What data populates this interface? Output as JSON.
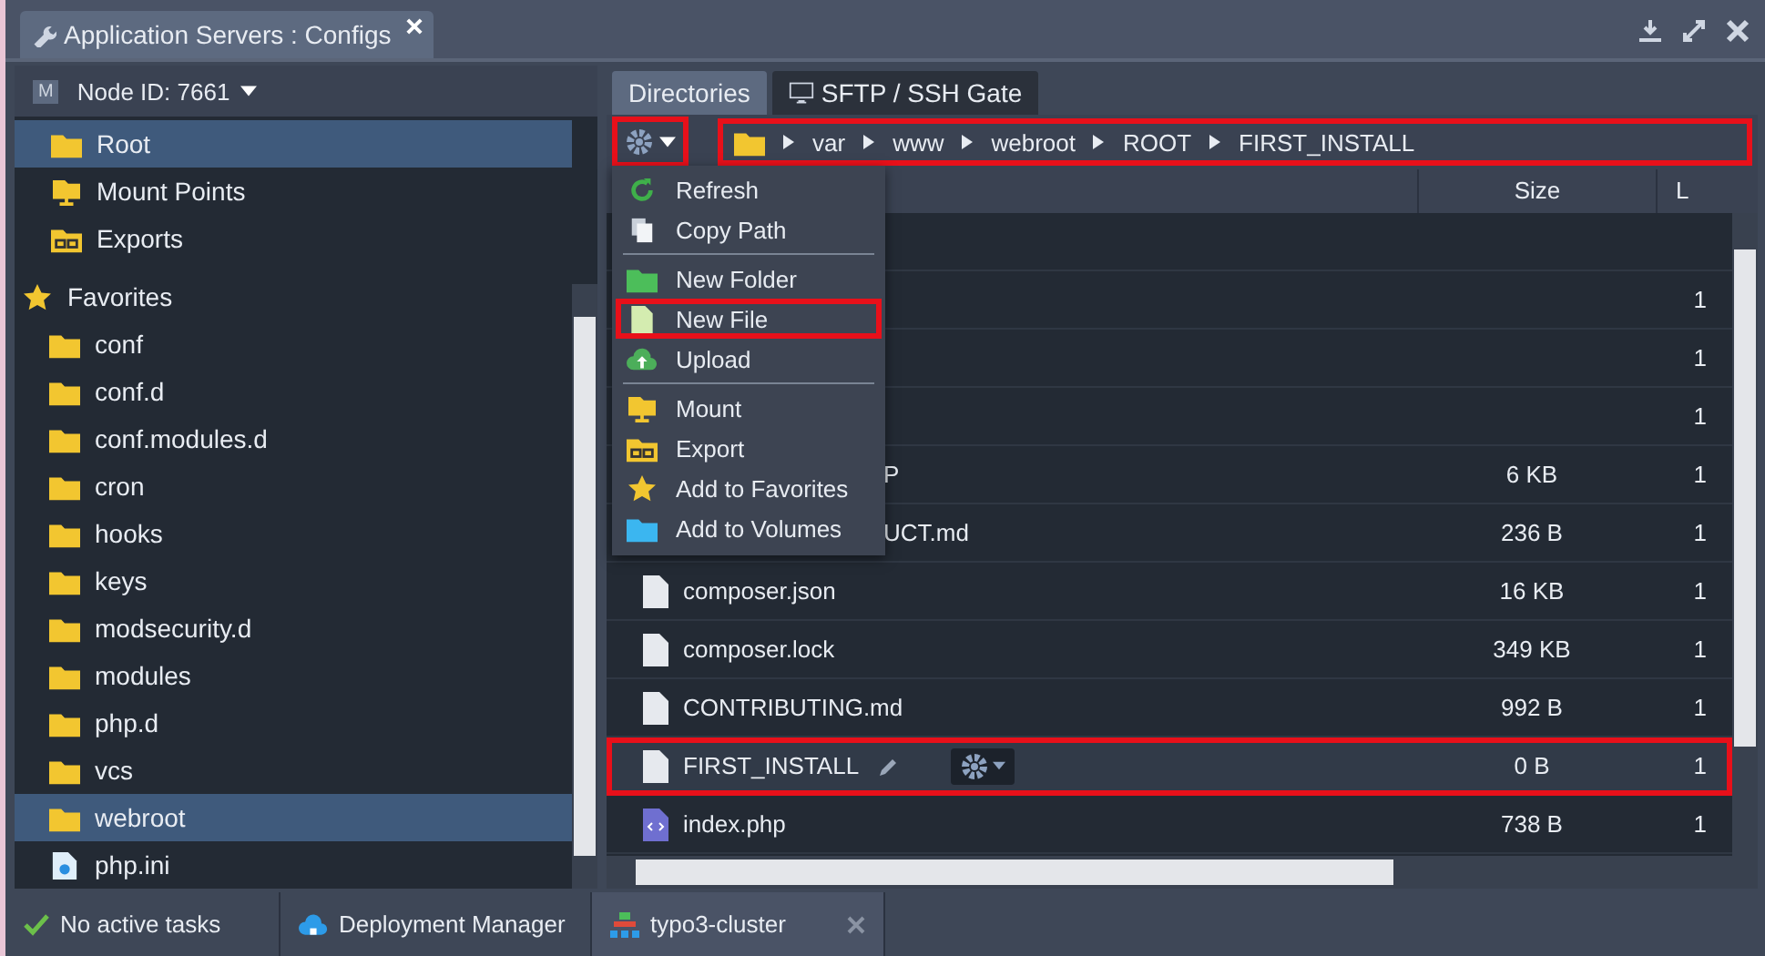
{
  "window": {
    "title": "Application Servers : Configs"
  },
  "sidebar": {
    "node": "Node ID: 7661",
    "node_badge": "M",
    "items": [
      {
        "label": "Root",
        "kind": "folder",
        "selected": true
      },
      {
        "label": "Mount Points",
        "kind": "mount",
        "selected": false
      },
      {
        "label": "Exports",
        "kind": "export",
        "selected": false
      }
    ],
    "favorites": {
      "label": "Favorites",
      "children": [
        {
          "label": "conf",
          "kind": "folder",
          "selected": false
        },
        {
          "label": "conf.d",
          "kind": "folder",
          "selected": false
        },
        {
          "label": "conf.modules.d",
          "kind": "folder",
          "selected": false
        },
        {
          "label": "cron",
          "kind": "folder",
          "selected": false
        },
        {
          "label": "hooks",
          "kind": "folder",
          "selected": false
        },
        {
          "label": "keys",
          "kind": "folder",
          "selected": false
        },
        {
          "label": "modsecurity.d",
          "kind": "folder",
          "selected": false
        },
        {
          "label": "modules",
          "kind": "folder",
          "selected": false
        },
        {
          "label": "php.d",
          "kind": "folder",
          "selected": false
        },
        {
          "label": "vcs",
          "kind": "folder",
          "selected": false
        },
        {
          "label": "webroot",
          "kind": "folder",
          "selected": true
        },
        {
          "label": "php.ini",
          "kind": "config",
          "selected": false
        }
      ]
    }
  },
  "tabs": [
    {
      "label": "Directories",
      "selected": true,
      "kind": "plain"
    },
    {
      "label": "SFTP / SSH Gate",
      "selected": false,
      "kind": "terminal"
    }
  ],
  "toolbar": {
    "gear_highlighted": true,
    "breadcrumb_highlighted": true,
    "breadcrumb": [
      "var",
      "www",
      "webroot",
      "ROOT",
      "FIRST_INSTALL"
    ]
  },
  "menu": {
    "groups": [
      [
        {
          "label": "Refresh",
          "kind": "refresh",
          "highlighted": false
        },
        {
          "label": "Copy Path",
          "kind": "copy",
          "highlighted": false
        }
      ],
      [
        {
          "label": "New Folder",
          "kind": "newfolder",
          "highlighted": false
        },
        {
          "label": "New File",
          "kind": "newfile",
          "highlighted": true
        },
        {
          "label": "Upload",
          "kind": "upload",
          "highlighted": false
        }
      ],
      [
        {
          "label": "Mount",
          "kind": "mount",
          "highlighted": false
        },
        {
          "label": "Export",
          "kind": "export",
          "highlighted": false
        },
        {
          "label": "Add to Favorites",
          "kind": "star",
          "highlighted": false
        },
        {
          "label": "Add to Volumes",
          "kind": "volume",
          "highlighted": false
        }
      ]
    ]
  },
  "table": {
    "columns": [
      {
        "label": "Size"
      },
      {
        "label": "L"
      }
    ],
    "rows": [
      {
        "kind": "hidden",
        "selected": false,
        "highlighted": false
      },
      {
        "kind": "hidden",
        "column_3": "1",
        "selected": false,
        "highlighted": false
      },
      {
        "kind": "hidden",
        "column_3": "1",
        "selected": false,
        "highlighted": false
      },
      {
        "kind": "hidden",
        "column_3": "1",
        "selected": false,
        "highlighted": false
      },
      {
        "kind": "partial",
        "name": "P",
        "size": "6 KB",
        "column_3": "1",
        "selected": false,
        "highlighted": false
      },
      {
        "kind": "partial",
        "name": "UCT.md",
        "size": "236 B",
        "column_3": "1",
        "selected": false,
        "highlighted": false
      },
      {
        "kind": "file",
        "name": "composer.json",
        "size": "16 KB",
        "column_3": "1",
        "selected": false,
        "highlighted": false
      },
      {
        "kind": "file",
        "name": "composer.lock",
        "size": "349 KB",
        "column_3": "1",
        "selected": false,
        "highlighted": false
      },
      {
        "kind": "file",
        "name": "CONTRIBUTING.md",
        "size": "992 B",
        "column_3": "1",
        "selected": false,
        "highlighted": false
      },
      {
        "kind": "file",
        "name": "FIRST_INSTALL",
        "size": "0 B",
        "column_3": "1",
        "selected": true,
        "highlighted": true
      },
      {
        "kind": "php",
        "name": "index.php",
        "size": "738 B",
        "column_3": "1",
        "selected": false,
        "highlighted": false
      }
    ]
  },
  "status_bar": [
    {
      "label": "No active tasks",
      "kind": "check",
      "selected": false,
      "closable": false
    },
    {
      "label": "Deployment Manager",
      "kind": "cloud",
      "selected": false,
      "closable": false
    },
    {
      "label": "typo3-cluster",
      "kind": "cluster",
      "selected": true,
      "closable": true
    }
  ]
}
